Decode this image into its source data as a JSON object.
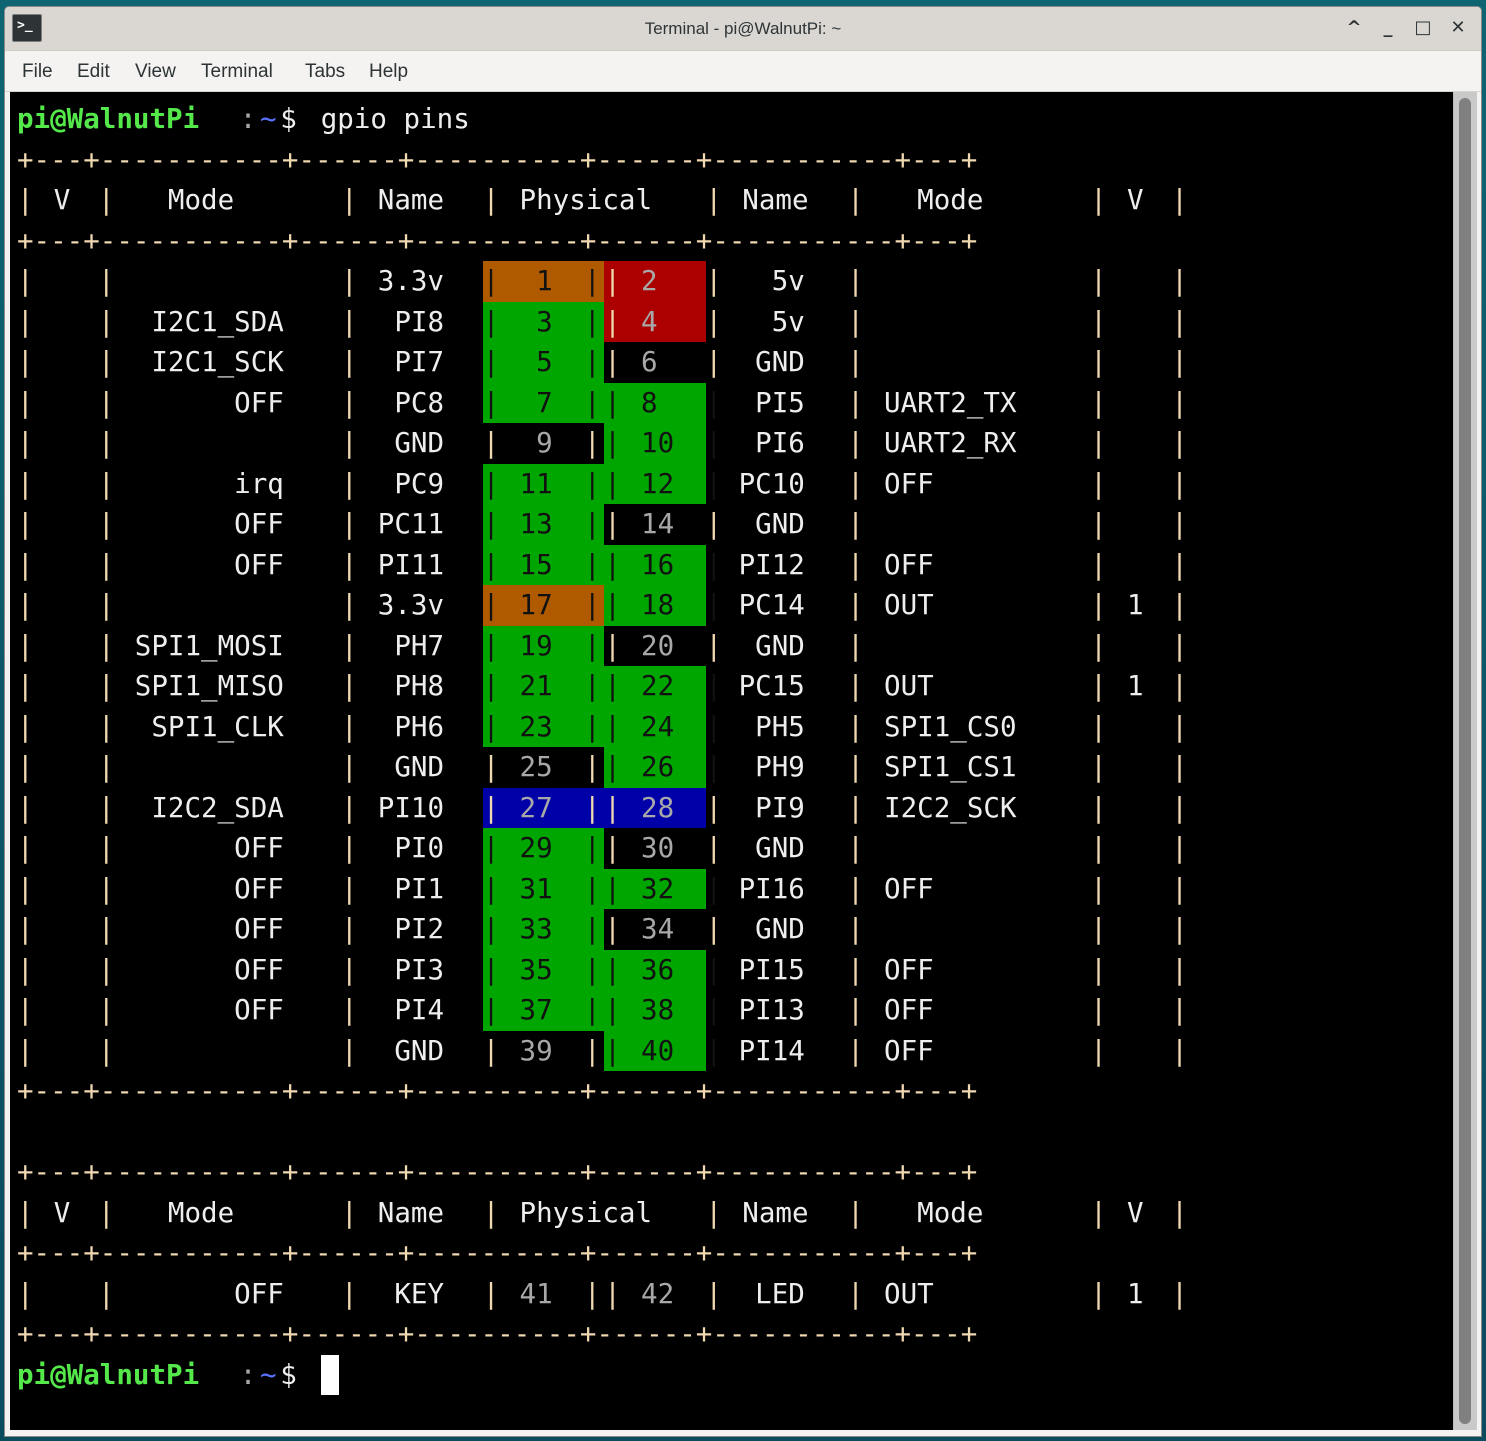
{
  "window": {
    "title": "Terminal - pi@WalnutPi: ~",
    "app_icon": ">_",
    "controls": {
      "shade": "^",
      "minimize": "_",
      "maximize": "□",
      "close": "✕"
    }
  },
  "menu": [
    "File",
    "Edit",
    "View",
    "Terminal",
    "Tabs",
    "Help"
  ],
  "colors": {
    "prompt_user": "#55e84a",
    "prompt_tilde": "#5b74ff",
    "pin_3v3": "#b05a00",
    "pin_5v": "#ac0000",
    "pin_gpio": "#00a600",
    "pin_i2c2": "#0000a8",
    "background": "#000000"
  },
  "prompt": {
    "user_host": "pi@WalnutPi",
    "sep": ":",
    "path": "~",
    "symbol": "$"
  },
  "command": "gpio pins",
  "table_header": [
    "V",
    "Mode",
    "Name",
    "Physical",
    "Name",
    "Mode",
    "V"
  ],
  "rows": [
    {
      "lv": "",
      "lmode": "",
      "lname": "3.3v",
      "lpin": "1",
      "rpin": "2",
      "rname": "5v",
      "rmode": "",
      "rv": "",
      "lcolor": "orange",
      "rcolor": "red"
    },
    {
      "lv": "",
      "lmode": "I2C1_SDA",
      "lname": "PI8",
      "lpin": "3",
      "rpin": "4",
      "rname": "5v",
      "rmode": "",
      "rv": "",
      "lcolor": "green",
      "rcolor": "red"
    },
    {
      "lv": "",
      "lmode": "I2C1_SCK",
      "lname": "PI7",
      "lpin": "5",
      "rpin": "6",
      "rname": "GND",
      "rmode": "",
      "rv": "",
      "lcolor": "green",
      "rcolor": "none"
    },
    {
      "lv": "",
      "lmode": "OFF",
      "lname": "PC8",
      "lpin": "7",
      "rpin": "8",
      "rname": "PI5",
      "rmode": "UART2_TX",
      "rv": "",
      "lcolor": "green",
      "rcolor": "green"
    },
    {
      "lv": "",
      "lmode": "",
      "lname": "GND",
      "lpin": "9",
      "rpin": "10",
      "rname": "PI6",
      "rmode": "UART2_RX",
      "rv": "",
      "lcolor": "none",
      "rcolor": "green"
    },
    {
      "lv": "",
      "lmode": "irq",
      "lname": "PC9",
      "lpin": "11",
      "rpin": "12",
      "rname": "PC10",
      "rmode": "OFF",
      "rv": "",
      "lcolor": "green",
      "rcolor": "green"
    },
    {
      "lv": "",
      "lmode": "OFF",
      "lname": "PC11",
      "lpin": "13",
      "rpin": "14",
      "rname": "GND",
      "rmode": "",
      "rv": "",
      "lcolor": "green",
      "rcolor": "none"
    },
    {
      "lv": "",
      "lmode": "OFF",
      "lname": "PI11",
      "lpin": "15",
      "rpin": "16",
      "rname": "PI12",
      "rmode": "OFF",
      "rv": "",
      "lcolor": "green",
      "rcolor": "green"
    },
    {
      "lv": "",
      "lmode": "",
      "lname": "3.3v",
      "lpin": "17",
      "rpin": "18",
      "rname": "PC14",
      "rmode": "OUT",
      "rv": "1",
      "lcolor": "orange",
      "rcolor": "green"
    },
    {
      "lv": "",
      "lmode": "SPI1_MOSI",
      "lname": "PH7",
      "lpin": "19",
      "rpin": "20",
      "rname": "GND",
      "rmode": "",
      "rv": "",
      "lcolor": "green",
      "rcolor": "none"
    },
    {
      "lv": "",
      "lmode": "SPI1_MISO",
      "lname": "PH8",
      "lpin": "21",
      "rpin": "22",
      "rname": "PC15",
      "rmode": "OUT",
      "rv": "1",
      "lcolor": "green",
      "rcolor": "green"
    },
    {
      "lv": "",
      "lmode": "SPI1_CLK",
      "lname": "PH6",
      "lpin": "23",
      "rpin": "24",
      "rname": "PH5",
      "rmode": "SPI1_CS0",
      "rv": "",
      "lcolor": "green",
      "rcolor": "green"
    },
    {
      "lv": "",
      "lmode": "",
      "lname": "GND",
      "lpin": "25",
      "rpin": "26",
      "rname": "PH9",
      "rmode": "SPI1_CS1",
      "rv": "",
      "lcolor": "none",
      "rcolor": "green"
    },
    {
      "lv": "",
      "lmode": "I2C2_SDA",
      "lname": "PI10",
      "lpin": "27",
      "rpin": "28",
      "rname": "PI9",
      "rmode": "I2C2_SCK",
      "rv": "",
      "lcolor": "blue",
      "rcolor": "blue"
    },
    {
      "lv": "",
      "lmode": "OFF",
      "lname": "PI0",
      "lpin": "29",
      "rpin": "30",
      "rname": "GND",
      "rmode": "",
      "rv": "",
      "lcolor": "green",
      "rcolor": "none"
    },
    {
      "lv": "",
      "lmode": "OFF",
      "lname": "PI1",
      "lpin": "31",
      "rpin": "32",
      "rname": "PI16",
      "rmode": "OFF",
      "rv": "",
      "lcolor": "green",
      "rcolor": "green"
    },
    {
      "lv": "",
      "lmode": "OFF",
      "lname": "PI2",
      "lpin": "33",
      "rpin": "34",
      "rname": "GND",
      "rmode": "",
      "rv": "",
      "lcolor": "green",
      "rcolor": "none"
    },
    {
      "lv": "",
      "lmode": "OFF",
      "lname": "PI3",
      "lpin": "35",
      "rpin": "36",
      "rname": "PI15",
      "rmode": "OFF",
      "rv": "",
      "lcolor": "green",
      "rcolor": "green"
    },
    {
      "lv": "",
      "lmode": "OFF",
      "lname": "PI4",
      "lpin": "37",
      "rpin": "38",
      "rname": "PI13",
      "rmode": "OFF",
      "rv": "",
      "lcolor": "green",
      "rcolor": "green"
    },
    {
      "lv": "",
      "lmode": "",
      "lname": "GND",
      "lpin": "39",
      "rpin": "40",
      "rname": "PI14",
      "rmode": "OFF",
      "rv": "",
      "lcolor": "none",
      "rcolor": "green"
    }
  ],
  "extra_rows": [
    {
      "lv": "",
      "lmode": "OFF",
      "lname": "KEY",
      "lpin": "41",
      "rpin": "42",
      "rname": "LED",
      "rmode": "OUT",
      "rv": "1",
      "lcolor": "none",
      "rcolor": "none"
    }
  ]
}
